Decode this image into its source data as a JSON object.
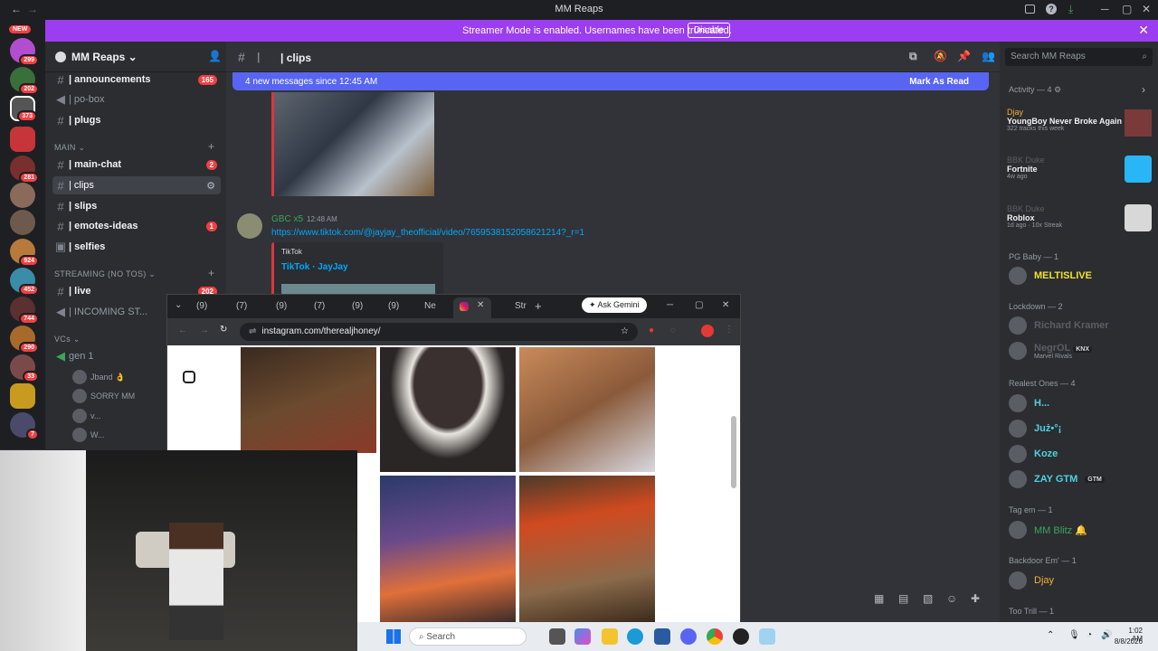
{
  "window": {
    "title": "MM Reaps",
    "back": "←",
    "fwd": "→"
  },
  "banner": {
    "text": "Streamer Mode is enabled. Usernames have been truncated.",
    "button": "Disable",
    "close": "✕"
  },
  "rail": {
    "new_label": "NEW",
    "badges": [
      "299",
      "202",
      "373",
      "281",
      "924",
      "452",
      "744",
      "290",
      "33",
      "7"
    ]
  },
  "server": {
    "name": "MM Reaps ⌄"
  },
  "channels_top": [
    {
      "name": "| announcements",
      "badge": "165",
      "unread": true
    },
    {
      "name": "| po-box",
      "badge": "",
      "unread": false
    },
    {
      "name": "| plugs",
      "badge": "",
      "unread": true
    }
  ],
  "cat_main": "MAIN ⌄",
  "channels_main": [
    {
      "name": "| main-chat",
      "badge": "2",
      "unread": true
    },
    {
      "name": "| clips",
      "badge": "",
      "unread": false
    },
    {
      "name": "| slips",
      "badge": "",
      "unread": true
    },
    {
      "name": "| emotes-ideas",
      "badge": "1",
      "unread": true
    },
    {
      "name": "| selfies",
      "badge": "",
      "unread": true
    }
  ],
  "cat_stream": "STREAMING (NO TOS) ⌄",
  "channels_stream": [
    {
      "name": "| live",
      "badge": "202",
      "unread": true
    },
    {
      "name": "| INCOMING ST...",
      "badge": "",
      "unread": false
    }
  ],
  "cat_vc": "VCs ⌄",
  "vc": {
    "name": "gen 1",
    "users": [
      "Jband 👌",
      "SORRY MM",
      "v...",
      "W..."
    ]
  },
  "header": {
    "channel": "| clips"
  },
  "newmsg": {
    "text": "4 new messages since 12:45 AM",
    "action": "Mark As Read"
  },
  "message": {
    "author": "GBC x5",
    "time": "12:48 AM",
    "link": "https://www.tiktok.com/@jayjay_theofficial/video/7659538152058621214?_r=1",
    "embed_site": "TikTok",
    "embed_title": "TikTok · JayJay"
  },
  "members": {
    "search": "Search MM Reaps",
    "activity_header": "Activity — 4 ⚙",
    "activity": [
      {
        "user": "Djay",
        "title": "YoungBoy Never Broke Again",
        "sub": "322 tracks this week"
      },
      {
        "user": "BBK Duke",
        "title": "Fortnite",
        "sub": "4w ago"
      },
      {
        "user": "BBK Duke",
        "title": "Roblox",
        "sub": "1d ago · 10x Streak"
      }
    ],
    "groups": [
      {
        "header": "PG Baby — 1",
        "members": [
          {
            "name": "MELTISLIVE",
            "color": "#f0e130"
          }
        ]
      },
      {
        "header": "Lockdown — 2",
        "members": [
          {
            "name": "Richard Kramer",
            "color": "#5c5e66"
          },
          {
            "name": "NegrOL",
            "color": "#5c5e66",
            "sub": "Marvel Rivals",
            "tag": "KNX"
          }
        ]
      },
      {
        "header": "Realest Ones — 4",
        "members": [
          {
            "name": "H...",
            "color": "#4fd1e0"
          },
          {
            "name": "Już•°¡",
            "color": "#4fd1e0"
          },
          {
            "name": "Koze",
            "color": "#4fd1e0"
          },
          {
            "name": "ZAY GTM",
            "color": "#4fd1e0",
            "tag": "GTM"
          }
        ]
      },
      {
        "header": "Tag em — 1",
        "members": [
          {
            "name": "MM Blitz 🔔",
            "color": "#3ba55c"
          }
        ]
      },
      {
        "header": "Backdoor Em' — 1",
        "members": [
          {
            "name": "Djay",
            "color": "#f0b232"
          }
        ]
      },
      {
        "header": "Too Trill — 1",
        "members": []
      }
    ]
  },
  "browser": {
    "tabs": [
      "(9)",
      "(7)",
      "(9)",
      "(7)",
      "(9)",
      "(9)",
      "Ne",
      "",
      "Str"
    ],
    "gemini": "Ask Gemini",
    "url": "instagram.com/therealjhoney/",
    "win_min": "─",
    "win_max": "▢",
    "win_close": "✕",
    "new_tab": "+"
  },
  "taskbar": {
    "search": "Search",
    "time": "1:02 AM",
    "date": "8/8/2026"
  }
}
